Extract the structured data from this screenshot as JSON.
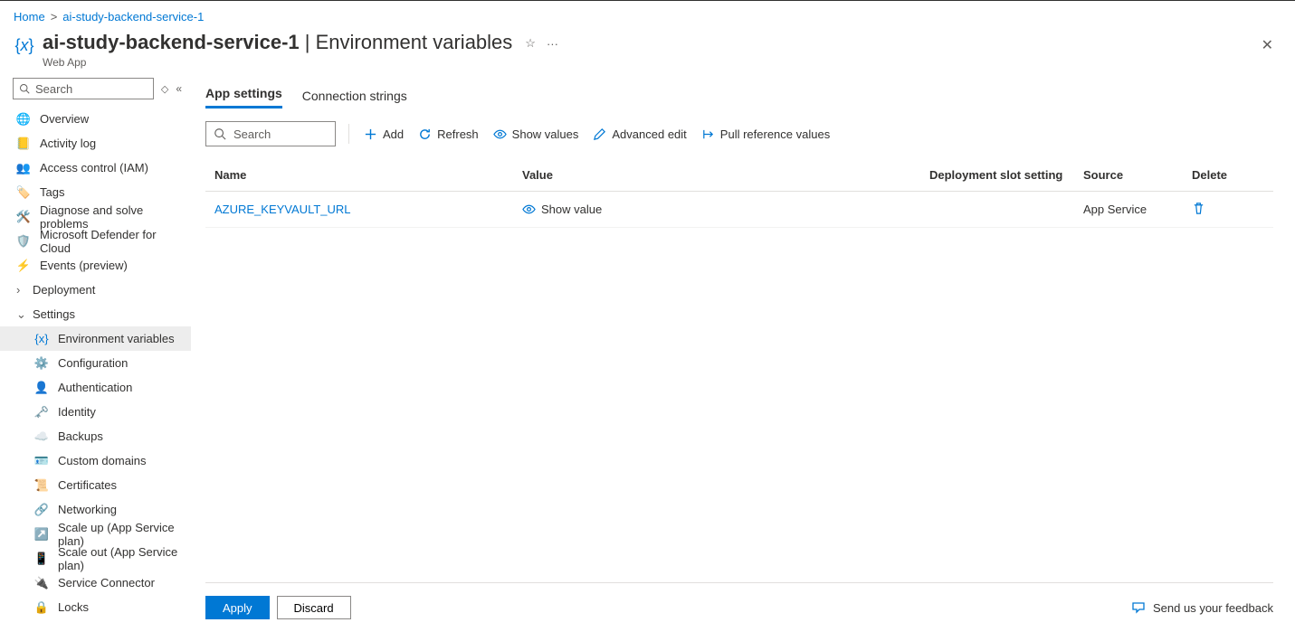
{
  "breadcrumb": {
    "home": "Home",
    "current": "ai-study-backend-service-1"
  },
  "header": {
    "resource": "ai-study-backend-service-1",
    "section": "Environment variables",
    "subtitle": "Web App"
  },
  "nav": {
    "search_placeholder": "Search",
    "items_top": [
      {
        "label": "Overview",
        "icon": "globe"
      },
      {
        "label": "Activity log",
        "icon": "log"
      },
      {
        "label": "Access control (IAM)",
        "icon": "people"
      },
      {
        "label": "Tags",
        "icon": "tag"
      },
      {
        "label": "Diagnose and solve problems",
        "icon": "wrench"
      },
      {
        "label": "Microsoft Defender for Cloud",
        "icon": "shield"
      },
      {
        "label": "Events (preview)",
        "icon": "bolt"
      }
    ],
    "groups": [
      {
        "label": "Deployment",
        "expanded": false
      },
      {
        "label": "Settings",
        "expanded": true
      }
    ],
    "settings_children": [
      {
        "label": "Environment variables",
        "icon": "brackets",
        "selected": true
      },
      {
        "label": "Configuration",
        "icon": "sliders"
      },
      {
        "label": "Authentication",
        "icon": "person"
      },
      {
        "label": "Identity",
        "icon": "key"
      },
      {
        "label": "Backups",
        "icon": "cloud"
      },
      {
        "label": "Custom domains",
        "icon": "card"
      },
      {
        "label": "Certificates",
        "icon": "cert"
      },
      {
        "label": "Networking",
        "icon": "network"
      },
      {
        "label": "Scale up (App Service plan)",
        "icon": "scaleup"
      },
      {
        "label": "Scale out (App Service plan)",
        "icon": "scaleout"
      },
      {
        "label": "Service Connector",
        "icon": "connector"
      },
      {
        "label": "Locks",
        "icon": "lock"
      }
    ]
  },
  "tabs": {
    "app_settings": "App settings",
    "connection_strings": "Connection strings"
  },
  "toolbar": {
    "search_placeholder": "Search",
    "add": "Add",
    "refresh": "Refresh",
    "show_values": "Show values",
    "advanced_edit": "Advanced edit",
    "pull_reference": "Pull reference values"
  },
  "table": {
    "cols": {
      "name": "Name",
      "value": "Value",
      "slot": "Deployment slot setting",
      "source": "Source",
      "delete": "Delete"
    },
    "rows": [
      {
        "name": "AZURE_KEYVAULT_URL",
        "value_action": "Show value",
        "slot": "",
        "source": "App Service"
      }
    ]
  },
  "footer": {
    "apply": "Apply",
    "discard": "Discard",
    "feedback": "Send us your feedback"
  }
}
